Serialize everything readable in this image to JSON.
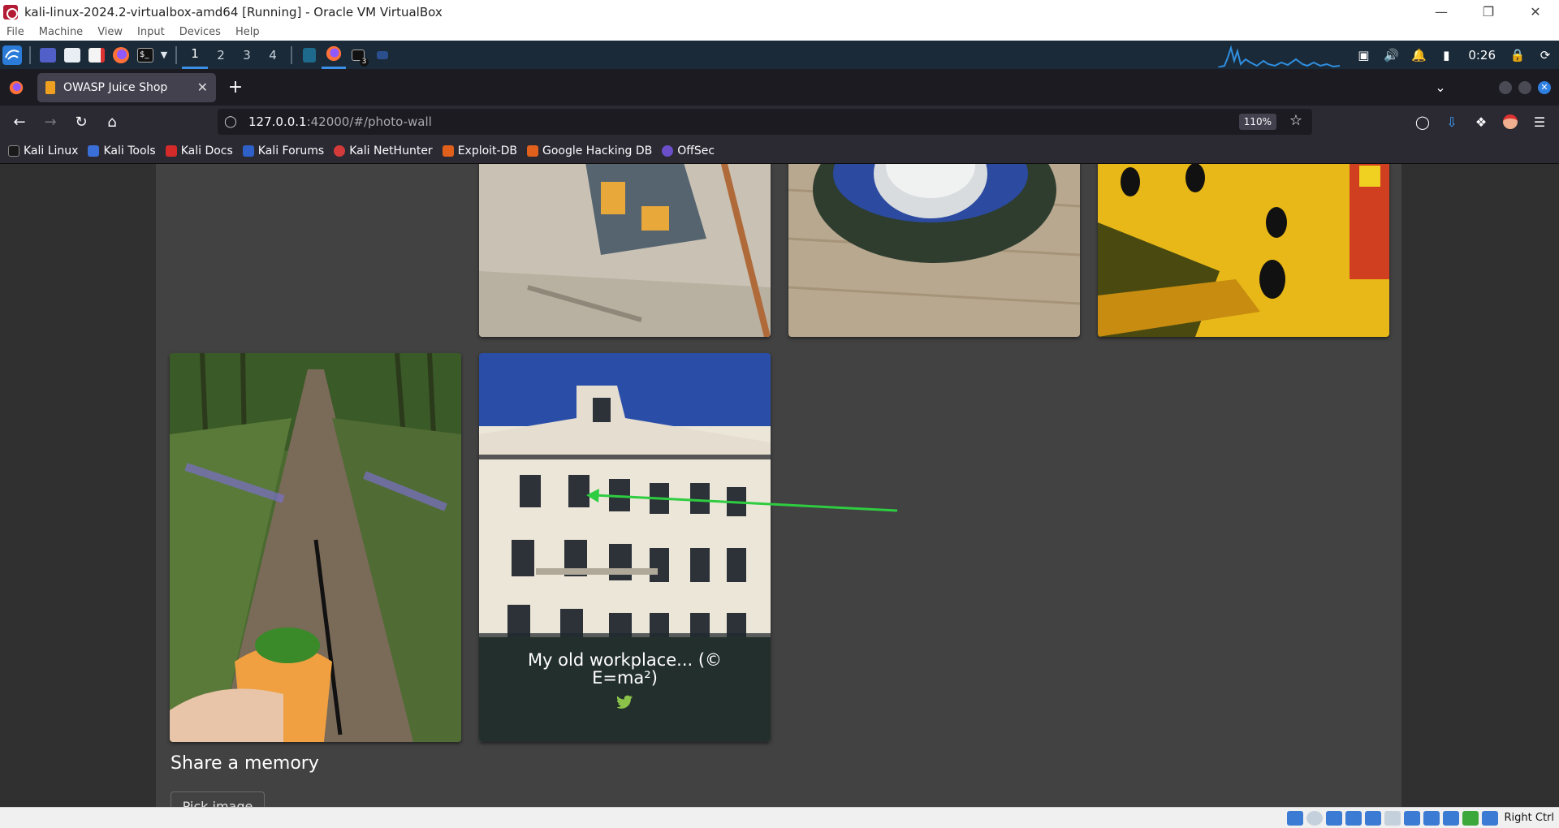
{
  "vbox": {
    "title": "kali-linux-2024.2-virtualbox-amd64 [Running] - Oracle VM VirtualBox",
    "menu": [
      "File",
      "Machine",
      "View",
      "Input",
      "Devices",
      "Help"
    ],
    "host_key": "Right Ctrl"
  },
  "panel": {
    "workspaces": [
      "1",
      "2",
      "3",
      "4"
    ],
    "active_workspace": "1",
    "clock": "0:26",
    "terminal_badge": "3"
  },
  "browser": {
    "tab_title": "OWASP Juice Shop",
    "url_host": "127.0.0.1",
    "url_rest": ":42000/#/photo-wall",
    "zoom": "110%",
    "bookmarks": [
      "Kali Linux",
      "Kali Tools",
      "Kali Docs",
      "Kali Forums",
      "Kali NetHunter",
      "Exploit-DB",
      "Google Hacking DB",
      "OffSec"
    ]
  },
  "page": {
    "caption": "My old workplace... (© E=ma²)",
    "share_title": "Share a memory",
    "pick_button": "Pick image"
  },
  "colors": {
    "page_bg": "#303030",
    "card_bg": "#424242",
    "accent_twitter": "#8bc34a",
    "annotation_arrow": "#2ecc40"
  }
}
